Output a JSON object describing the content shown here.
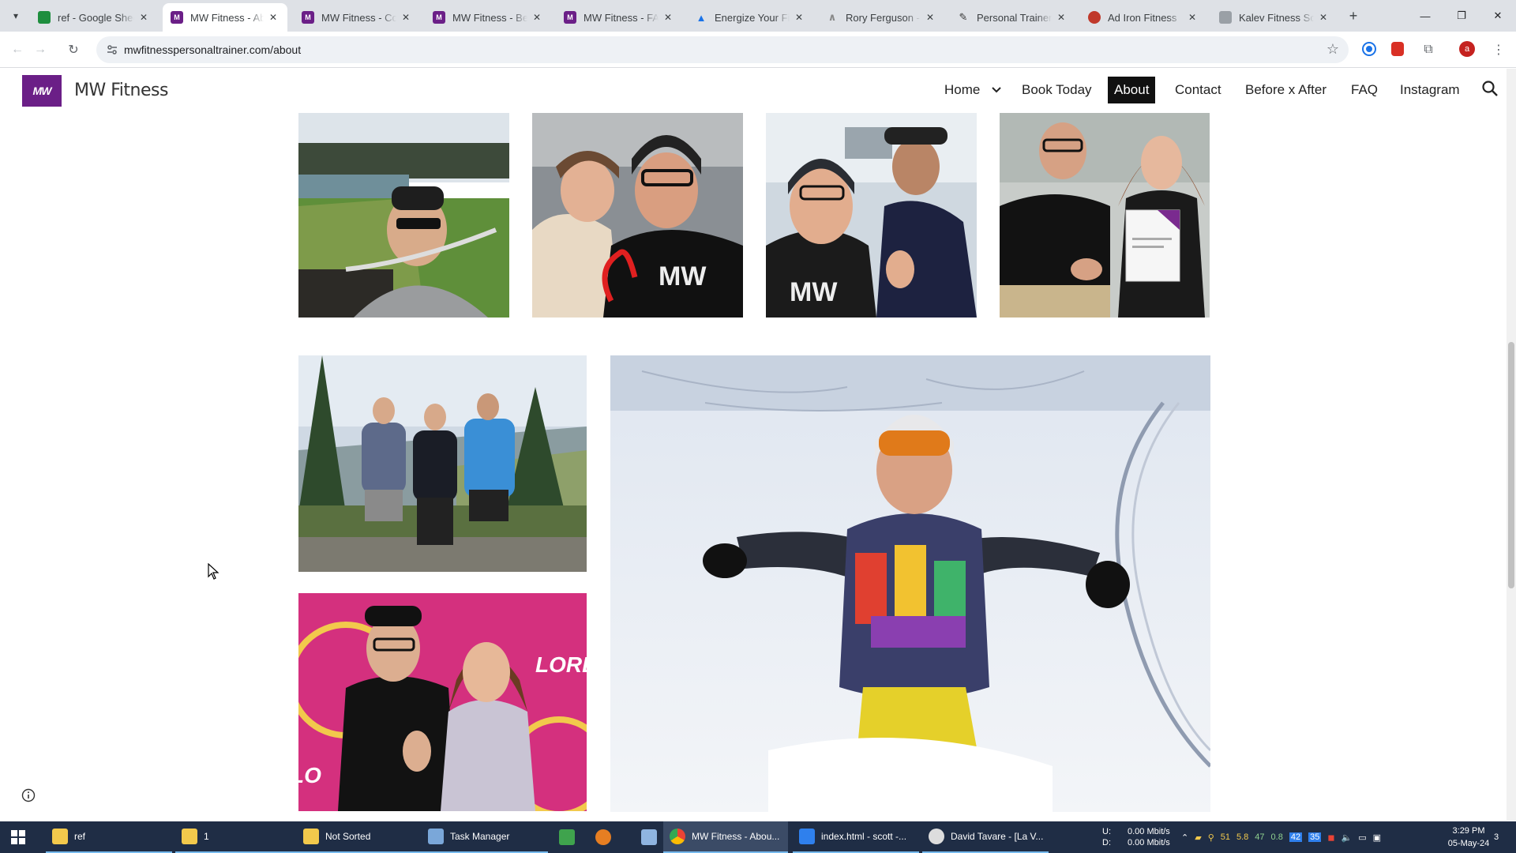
{
  "browser": {
    "tabs": [
      {
        "title": "ref - Google Sheets",
        "favicon": "sheets-icon",
        "color": "#1e8e3e",
        "active": false
      },
      {
        "title": "MW Fitness - About",
        "favicon": "mw-logo-icon",
        "color": "#6b1f87",
        "active": true
      },
      {
        "title": "MW Fitness - Contact",
        "favicon": "mw-logo-icon",
        "color": "#6b1f87",
        "active": false
      },
      {
        "title": "MW Fitness - Before x After",
        "favicon": "mw-logo-icon",
        "color": "#6b1f87",
        "active": false
      },
      {
        "title": "MW Fitness - FAQ",
        "favicon": "mw-logo-icon",
        "color": "#6b1f87",
        "active": false
      },
      {
        "title": "Energize Your Fitness",
        "favicon": "energize-icon",
        "color": "#1a73e8",
        "active": false
      },
      {
        "title": "Rory Ferguson - Personal Trainer",
        "favicon": "rf-icon",
        "color": "#888888",
        "active": false
      },
      {
        "title": "Personal Trainer Website",
        "favicon": "tools-icon",
        "color": "#333333",
        "active": false
      },
      {
        "title": "Ad Iron Fitness",
        "favicon": "iron-icon",
        "color": "#c0392b",
        "active": false
      },
      {
        "title": "Kalev Fitness Solutions",
        "favicon": "kalev-icon",
        "color": "#9aa0a6",
        "active": false
      }
    ],
    "url": "mwfitnesspersonaltrainer.com/about",
    "profile_initial": "a"
  },
  "site": {
    "logo_text": "MW",
    "title": "MW Fitness",
    "nav": {
      "home": "Home",
      "book": "Book Today",
      "about": "About",
      "contact": "Contact",
      "before_after": "Before x After",
      "faq": "FAQ",
      "instagram": "Instagram"
    },
    "accent": "#6b1f87"
  },
  "gallery": {
    "photos": [
      {
        "name": "photo-lake-cyclist-selfie"
      },
      {
        "name": "photo-gym-selfie-pair"
      },
      {
        "name": "photo-gym-thumbs-up"
      },
      {
        "name": "photo-certificate"
      },
      {
        "name": "photo-mountain-trio"
      },
      {
        "name": "photo-pink-backdrop-pair"
      },
      {
        "name": "photo-snow-skier"
      }
    ]
  },
  "taskbar": {
    "items": [
      {
        "label": "ref",
        "icon": "folder-icon",
        "color": "#f2c94c"
      },
      {
        "label": "1",
        "icon": "folder-icon",
        "color": "#f2c94c"
      },
      {
        "label": "Not Sorted",
        "icon": "folder-icon",
        "color": "#f2c94c"
      },
      {
        "label": "Task Manager",
        "icon": "task-manager-icon",
        "color": "#7aa7d9"
      },
      {
        "label": "",
        "icon": "notepad-green-icon",
        "color": "#3fa34d"
      },
      {
        "label": "",
        "icon": "app-orange-icon",
        "color": "#e67e22"
      },
      {
        "label": "",
        "icon": "notepad-icon",
        "color": "#8fb4e0"
      },
      {
        "label": "MW Fitness - Abou...",
        "icon": "chrome-icon",
        "color": "#ea4335"
      },
      {
        "label": "index.html - scott -...",
        "icon": "vscode-icon",
        "color": "#2f80ed"
      },
      {
        "label": "David Tavare - [La V...",
        "icon": "app-icon",
        "color": "#dddddd"
      }
    ],
    "net_up_label": "U:",
    "net_down_label": "D:",
    "net_up": "0.00 Mbit/s",
    "net_down": "0.00 Mbit/s",
    "tray_numbers": [
      "51",
      "5.8",
      "47",
      "0.8",
      "42",
      "35"
    ],
    "time": "3:29 PM",
    "date": "05-May-24",
    "notification_count": "3"
  }
}
